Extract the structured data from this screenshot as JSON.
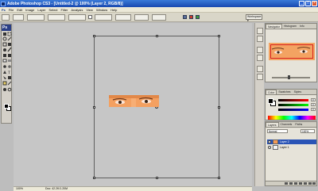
{
  "window": {
    "title": "Adobe Photoshop CS3 - [Untitled-2 @ 100% (Layer 2, RGB/8)]",
    "buttons": {
      "minimize": "_",
      "restore": "□",
      "close": "×"
    }
  },
  "menubar": {
    "app_badge": "Ps",
    "items": [
      "File",
      "Edit",
      "Image",
      "Layer",
      "Select",
      "Filter",
      "Analysis",
      "View",
      "Window",
      "Help"
    ]
  },
  "options_bar": {
    "workspace_label": "Workspace ▾"
  },
  "toolbox": {
    "header": "Ps",
    "tool_icons": [
      "move-icon",
      "marquee-icon",
      "lasso-icon",
      "magic-wand-icon",
      "crop-icon",
      "slice-icon",
      "healing-brush-icon",
      "brush-icon",
      "clone-stamp-icon",
      "history-brush-icon",
      "eraser-icon",
      "gradient-icon",
      "blur-icon",
      "dodge-icon",
      "pen-icon",
      "type-icon",
      "path-select-icon",
      "shape-icon",
      "notes-icon",
      "eyedropper-icon",
      "hand-icon",
      "zoom-icon"
    ],
    "foreground_color": "#000000",
    "background_color": "#ffffff"
  },
  "document": {
    "status_zoom": "100%",
    "status_doc": "Doc: 42.2K/1.20M"
  },
  "navigator_panel": {
    "tabs": [
      "Navigator",
      "Histogram",
      "Info"
    ]
  },
  "color_panel": {
    "tabs": [
      "Color",
      "Swatches",
      "Styles"
    ],
    "values": [
      "0",
      "0",
      "0"
    ]
  },
  "layers_panel": {
    "tabs": [
      "Layers",
      "Channels",
      "Paths"
    ],
    "blend_mode": "Normal",
    "opacity": "100%",
    "layers": [
      {
        "name": "Layer 2",
        "selected": true
      },
      {
        "name": "Layer 1",
        "selected": false
      }
    ]
  },
  "colors": {
    "title_bar": "#1f57c3",
    "skin": "#f59a55",
    "selection": "#2a54b6",
    "canvas_bg": "#c6c6c6"
  }
}
